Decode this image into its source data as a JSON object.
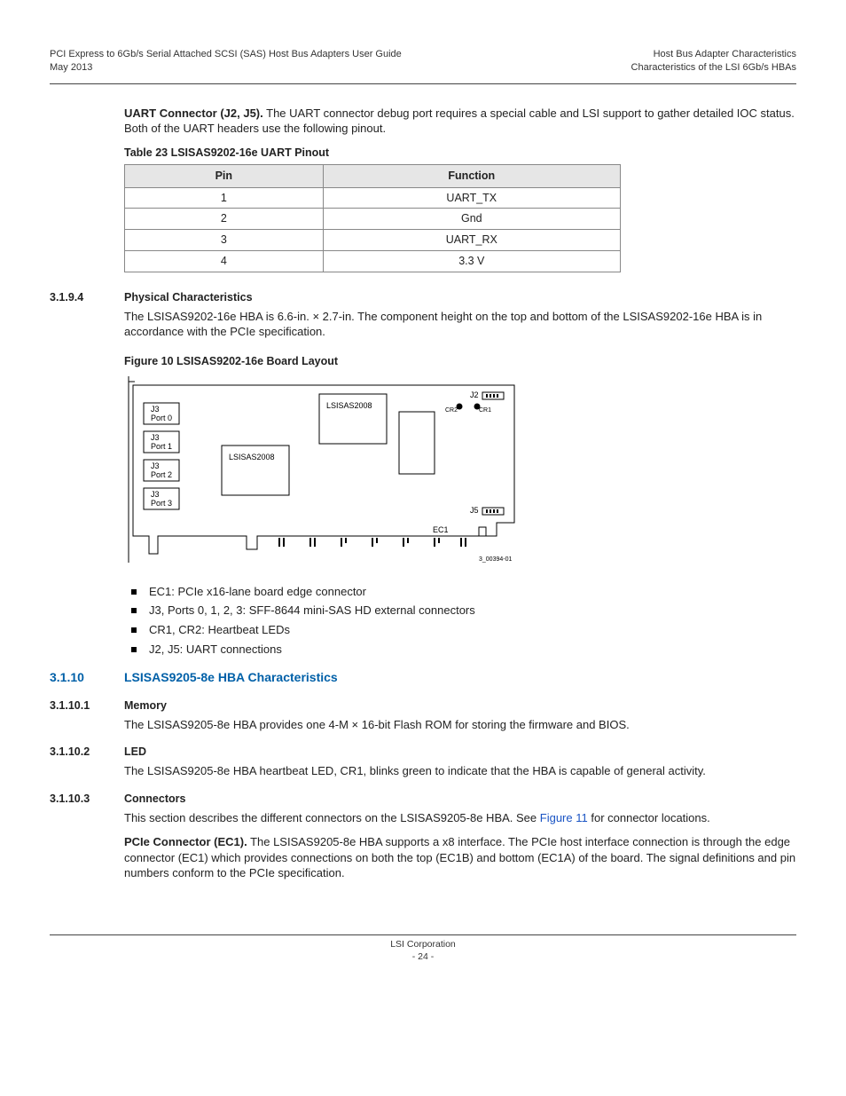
{
  "header": {
    "left1": "PCI Express to 6Gb/s Serial Attached SCSI (SAS) Host Bus Adapters User Guide",
    "left2": "May 2013",
    "right1": "Host Bus Adapter Characteristics",
    "right2": "Characteristics of the LSI 6Gb/s HBAs"
  },
  "intro": {
    "uart_bold": "UART Connector (J2, J5).",
    "uart_text": " The UART connector debug port requires a special cable and LSI support to gather detailed IOC status. Both of the UART headers use the following pinout."
  },
  "table23": {
    "caption": "Table 23  LSISAS9202-16e UART Pinout",
    "col1": "Pin",
    "col2": "Function",
    "rows": [
      {
        "pin": "1",
        "func": "UART_TX"
      },
      {
        "pin": "2",
        "func": "Gnd"
      },
      {
        "pin": "3",
        "func": "UART_RX"
      },
      {
        "pin": "4",
        "func": "3.3 V"
      }
    ]
  },
  "sec3194": {
    "num": "3.1.9.4",
    "title": "Physical Characteristics",
    "body": "The LSISAS9202-16e HBA is 6.6-in. × 2.7-in. The component height on the top and bottom of the LSISAS9202-16e HBA is in accordance with the PCIe specification."
  },
  "figure10": {
    "caption": "Figure 10  LSISAS9202-16e Board Layout",
    "labels": {
      "j3p0a": "J3",
      "j3p0b": "Port 0",
      "j3p1a": "J3",
      "j3p1b": "Port 1",
      "j3p2a": "J3",
      "j3p2b": "Port 2",
      "j3p3a": "J3",
      "j3p3b": "Port 3",
      "chip1": "LSISAS2008",
      "chip2": "LSISAS2008",
      "j2": "J2",
      "cr1": "CR1",
      "cr2": "CR2",
      "j5": "J5",
      "ec1": "EC1",
      "partno": "3_00394-01"
    }
  },
  "bullets": {
    "b1": "EC1: PCIe x16-lane board edge connector",
    "b2": "J3, Ports 0, 1, 2, 3: SFF-8644 mini-SAS HD external connectors",
    "b3": "CR1, CR2: Heartbeat LEDs",
    "b4": "J2, J5: UART connections"
  },
  "sec3110": {
    "num": "3.1.10",
    "title": "LSISAS9205-8e HBA Characteristics"
  },
  "sec31101": {
    "num": "3.1.10.1",
    "title": "Memory",
    "body": "The LSISAS9205-8e HBA provides one 4-M × 16-bit Flash ROM for storing the firmware and BIOS."
  },
  "sec31102": {
    "num": "3.1.10.2",
    "title": "LED",
    "body": "The LSISAS9205-8e HBA heartbeat LED, CR1, blinks green to indicate that the HBA is capable of general activity."
  },
  "sec31103": {
    "num": "3.1.10.3",
    "title": "Connectors",
    "body_pre": "This section describes the different connectors on the LSISAS9205-8e HBA. See ",
    "body_link": "Figure 11",
    "body_post": " for connector locations.",
    "pcie_bold": "PCIe Connector (EC1).",
    "pcie_text": "  The LSISAS9205-8e HBA supports a x8 interface. The PCIe host interface connection is through the edge connector (EC1) which provides connections on both the top (EC1B) and bottom (EC1A) of the board. The signal definitions and pin numbers conform to the PCIe specification."
  },
  "footer": {
    "line1": "LSI Corporation",
    "line2": "- 24 -"
  }
}
